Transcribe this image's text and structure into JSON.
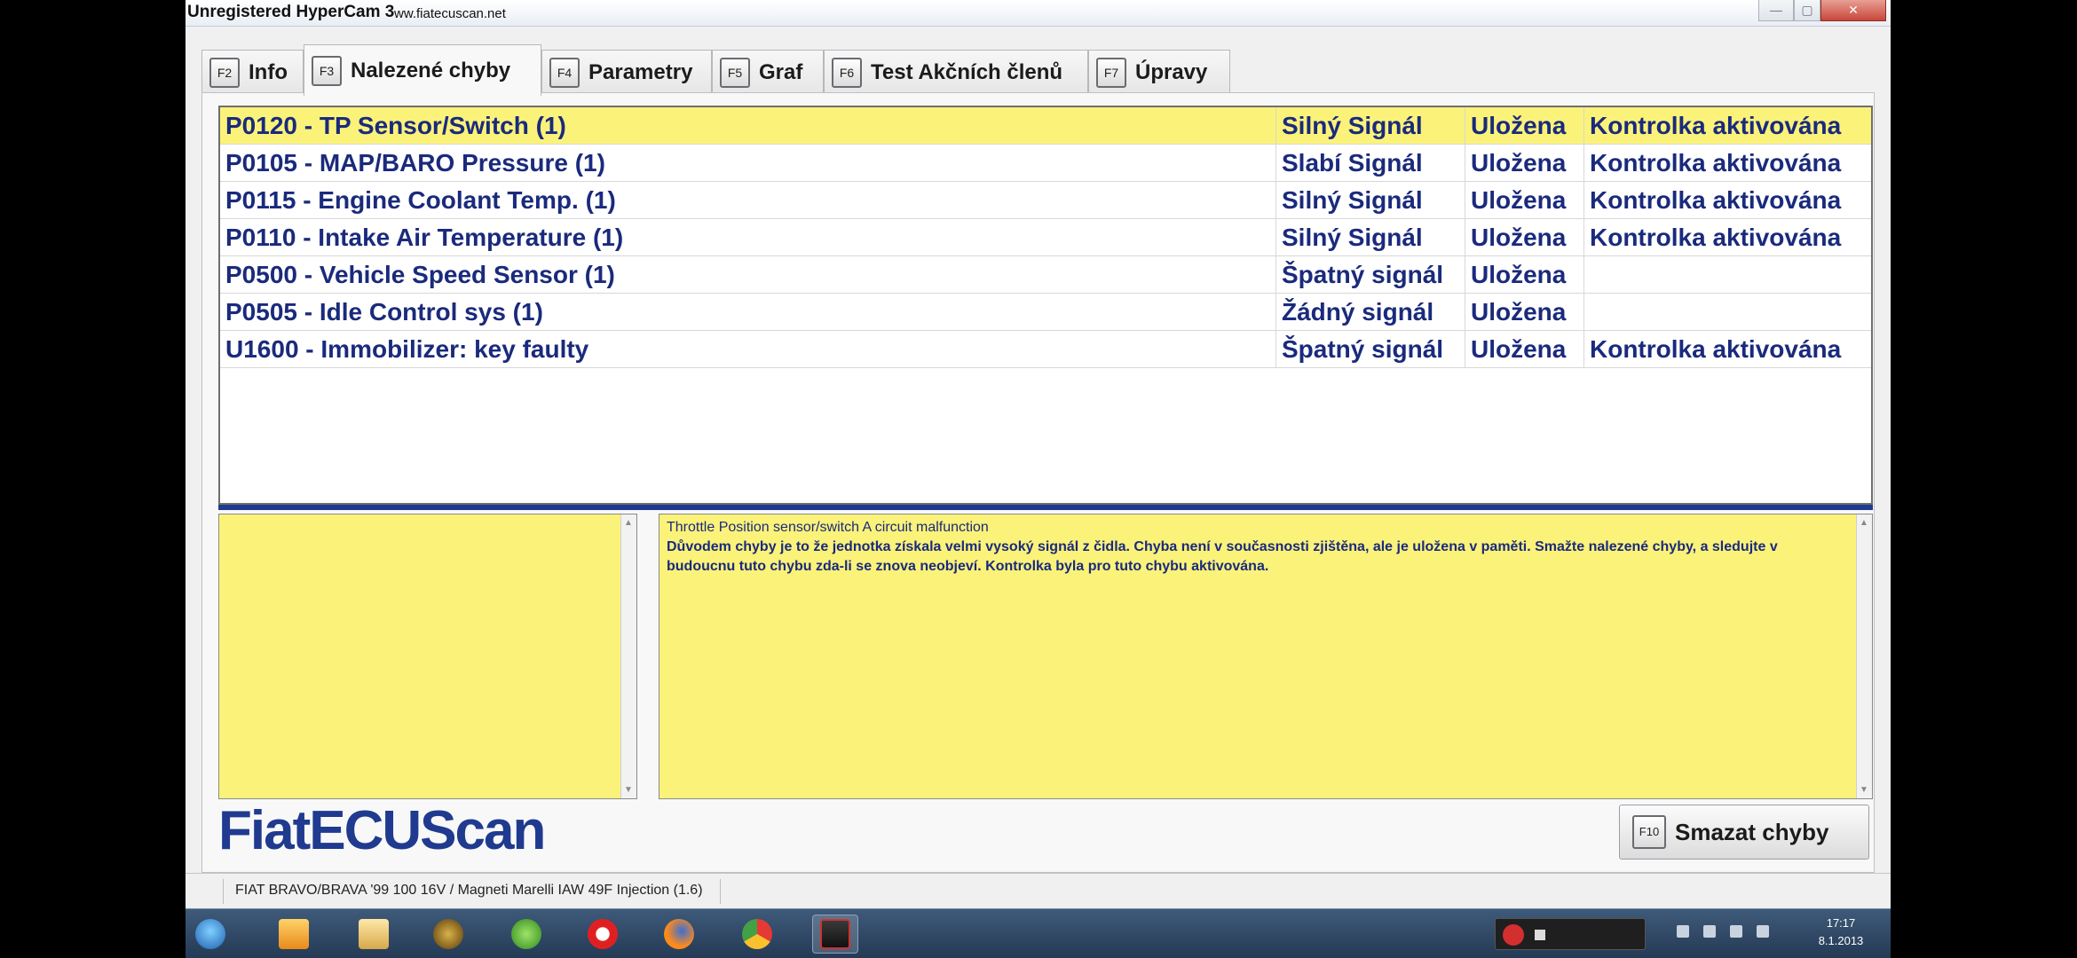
{
  "window": {
    "title": "Unregistered HyperCam 3",
    "subtitle": "ww.fiatecuscan.net"
  },
  "tabs": [
    {
      "key": "F2",
      "label": "Info"
    },
    {
      "key": "F3",
      "label": "Nalezené chyby",
      "active": true
    },
    {
      "key": "F4",
      "label": "Parametry"
    },
    {
      "key": "F5",
      "label": "Graf"
    },
    {
      "key": "F6",
      "label": "Test Akčních členů"
    },
    {
      "key": "F7",
      "label": "Úpravy"
    }
  ],
  "faults": [
    {
      "code": "P0120 - TP Sensor/Switch (1)",
      "signal": "Silný Signál",
      "stored": "Uložena",
      "lamp": "Kontrolka aktivována",
      "selected": true
    },
    {
      "code": "P0105 - MAP/BARO Pressure (1)",
      "signal": "Slabí Signál",
      "stored": "Uložena",
      "lamp": "Kontrolka aktivována"
    },
    {
      "code": "P0115 - Engine Coolant Temp. (1)",
      "signal": "Silný Signál",
      "stored": "Uložena",
      "lamp": "Kontrolka aktivována"
    },
    {
      "code": "P0110 - Intake Air Temperature (1)",
      "signal": "Silný Signál",
      "stored": "Uložena",
      "lamp": "Kontrolka aktivována"
    },
    {
      "code": "P0500 - Vehicle Speed Sensor (1)",
      "signal": "Špatný signál",
      "stored": "Uložena",
      "lamp": ""
    },
    {
      "code": "P0505 - Idle Control sys (1)",
      "signal": "Žádný signál",
      "stored": "Uložena",
      "lamp": ""
    },
    {
      "code": "U1600 - Immobilizer: key faulty",
      "signal": "Špatný signál",
      "stored": "Uložena",
      "lamp": "Kontrolka aktivována"
    }
  ],
  "description": {
    "heading": "Throttle Position sensor/switch A circuit malfunction",
    "body": "Důvodem chyby je to že jednotka získala velmi vysoký signál z čidla. Chyba není v současnosti zjištěna, ale je uložena v paměti. Smažte nalezené chyby, a sledujte v budoucnu tuto chybu zda-li se znova neobjeví. Kontrolka byla pro tuto chybu aktivována."
  },
  "logo": "FiatECUScan",
  "clear_button": {
    "key": "F10",
    "label": "Smazat chyby"
  },
  "status": "FIAT BRAVO/BRAVA '99 100 16V / Magneti Marelli IAW 49F Injection (1.6)",
  "clock": {
    "time": "17:17",
    "date": "8.1.2013"
  },
  "colors": {
    "highlight": "#fbf27a",
    "text_blue": "#1a2a7c",
    "accent": "#1f3b8f"
  }
}
